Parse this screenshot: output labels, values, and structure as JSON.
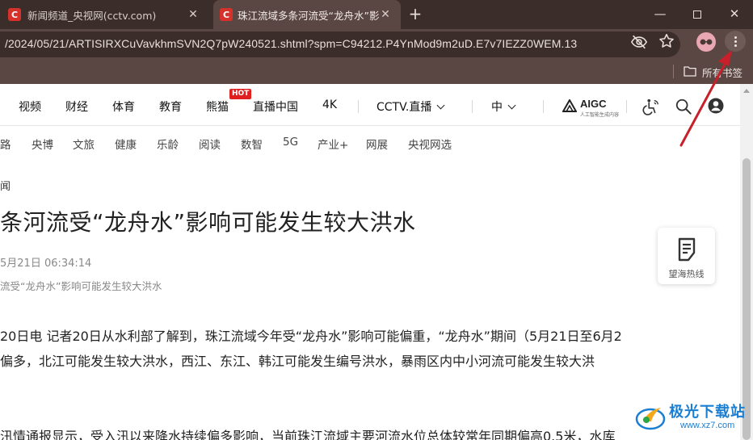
{
  "tabs": [
    {
      "title": "新闻频道_央视网(cctv.com)",
      "favicon": "C",
      "active": false
    },
    {
      "title": "珠江流域多条河流受“龙舟水”影",
      "favicon": "C",
      "active": true
    }
  ],
  "window_controls": {
    "minimize": "—",
    "restore": "",
    "close": "✕"
  },
  "new_tab": "+",
  "tab_close": "✕",
  "address_bar": {
    "url": "/2024/05/21/ARTISIRXCuVavkhmSVN2Q7pW240521.shtml?spm=C94212.P4YnMod9m2uD.E7v7IEZZ0WEM.13"
  },
  "bookmarks_bar": {
    "folder_label": "所有书签"
  },
  "site_nav": {
    "items": [
      "视频",
      "财经",
      "体育",
      "教育",
      "熊猫",
      "直播中国",
      "4K"
    ],
    "hot_badge": "HOT",
    "live_label": "CCTV.直播",
    "lang_label": "中",
    "aigc_label": "AIGC",
    "aigc_sub": "人工智能生成内容"
  },
  "sub_nav": {
    "items": [
      "路",
      "央博",
      "文旅",
      "健康",
      "乐龄",
      "阅读",
      "数智",
      "5G",
      "产业+",
      "网展",
      "央视网选"
    ]
  },
  "article": {
    "breadcrumb": "闻",
    "title": "条河流受“龙舟水”影响可能发生较大洪水",
    "pub_time": "5月21日 06:34:14",
    "subtitle": "流受“龙舟水”影响可能发生较大洪水",
    "paragraphs": [
      "20日电 记者20日从水利部了解到，珠江流域今年受“龙舟水”影响可能偏重，“龙舟水”期间（5月21日至6月2",
      "偏多，北江可能发生较大洪水，西江、东江、韩江可能发生编号洪水，暴雨区内中小河流可能发生较大洪",
      "汛情通报显示，受入汛以来降水持续偏多影响，当前珠江流域主要河流水位总体较常年同期偏高0.5米，水库"
    ]
  },
  "floating_widget": {
    "label": "望海热线"
  },
  "watermark": {
    "title": "极光下载站",
    "url": "www.xz7.com"
  },
  "colors": {
    "tabbar": "#3a2d2a",
    "toolbar": "#5a4743",
    "annotation_arrow": "#c8202a",
    "hot_badge": "#e02020"
  }
}
